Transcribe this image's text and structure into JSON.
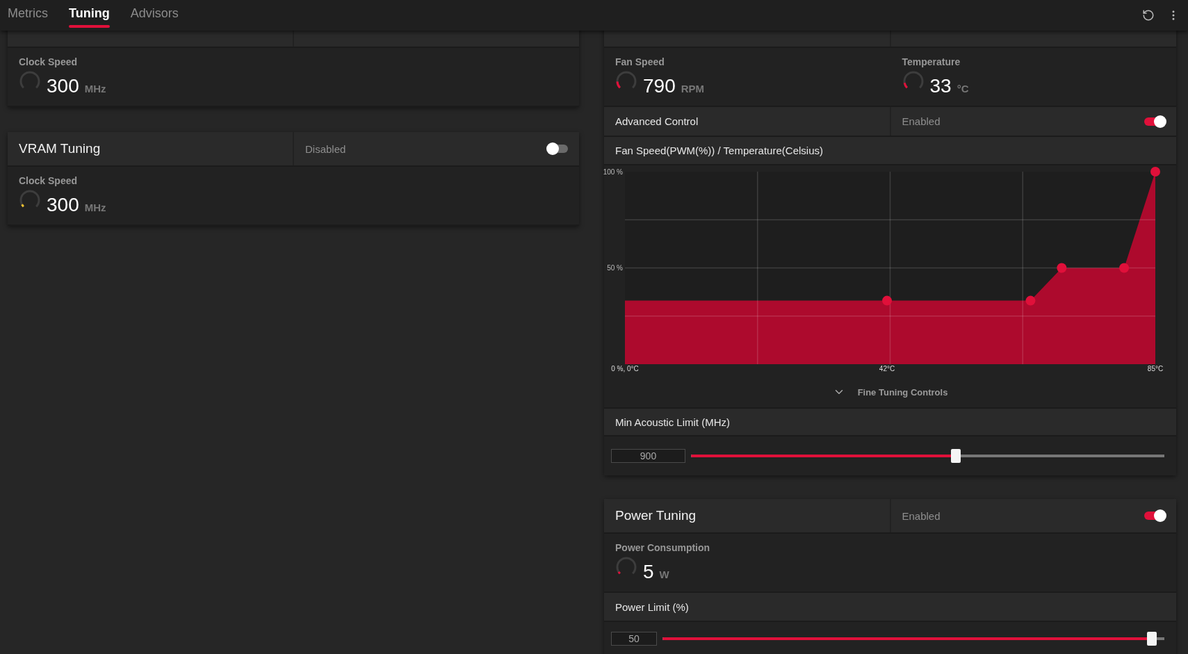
{
  "tabs": [
    {
      "label": "Metrics",
      "selected": false
    },
    {
      "label": "Tuning",
      "selected": true
    },
    {
      "label": "Advisors",
      "selected": false
    }
  ],
  "left_panels": [
    {
      "metrics": [
        {
          "label": "Clock Speed",
          "value": "300",
          "unit": "MHz",
          "level": 0
        }
      ]
    },
    {
      "title": "VRAM Tuning",
      "status": "Disabled",
      "on": false,
      "metrics": [
        {
          "label": "Clock Speed",
          "value": "300",
          "unit": "MHz",
          "level": 0.06,
          "color": "#f2c230"
        }
      ]
    }
  ],
  "fan_tuning": {
    "metrics": [
      {
        "label": "Fan Speed",
        "value": "790",
        "unit": "RPM",
        "level": 0.16,
        "color": "#e0103a"
      },
      {
        "label": "Temperature",
        "value": "33",
        "unit": "°C",
        "level": 0.13,
        "color": "#e0103a"
      }
    ],
    "advanced_control": {
      "label": "Advanced Control",
      "status": "Enabled",
      "on": true
    },
    "curve": {
      "title": "Fan Speed(PWM(%)) / Temperature(Celsius)",
      "chart_data": {
        "type": "area",
        "grid": true,
        "x": [
          0,
          42,
          65,
          70,
          80,
          85
        ],
        "xlim": [
          0,
          85
        ],
        "ylim": [
          0,
          100
        ],
        "series": [
          {
            "color": "#ad0a2d",
            "values": [
              33,
              33,
              33,
              50,
              50,
              100
            ]
          }
        ],
        "xticks": [
          {
            "value": 0,
            "label": "0 %, 0°C"
          },
          {
            "value": 42,
            "label": "42°C"
          },
          {
            "value": 85,
            "label": "85°C"
          }
        ],
        "yticks": [
          {
            "value": 50,
            "label": "50 %"
          },
          {
            "value": 100,
            "label": "100 %"
          }
        ]
      }
    },
    "fine_tuning": {
      "label": "Fine Tuning Controls"
    },
    "min_acoustic": {
      "label": "Min Acoustic Limit (MHz)",
      "value": "900",
      "level": 0.56
    }
  },
  "power_tuning": {
    "title": "Power Tuning",
    "status": "Enabled",
    "on": true,
    "metrics": [
      {
        "label": "Power Consumption",
        "value": "5",
        "unit": "W",
        "level": 0.05,
        "color": "#e0103a"
      }
    ],
    "power_limit": {
      "label": "Power Limit (%)",
      "value": "50",
      "level": 0.985
    }
  }
}
